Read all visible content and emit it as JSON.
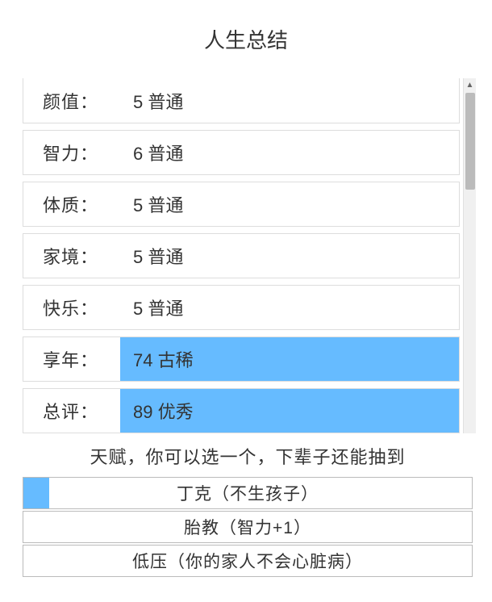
{
  "title": "人生总结",
  "stats": [
    {
      "label": "颜值：",
      "value": "5 普通",
      "highlighted": false
    },
    {
      "label": "智力：",
      "value": "6 普通",
      "highlighted": false
    },
    {
      "label": "体质：",
      "value": "5 普通",
      "highlighted": false
    },
    {
      "label": "家境：",
      "value": "5 普通",
      "highlighted": false
    },
    {
      "label": "快乐：",
      "value": "5 普通",
      "highlighted": false
    },
    {
      "label": "享年：",
      "value": "74 古稀",
      "highlighted": true
    },
    {
      "label": "总评：",
      "value": "89 优秀",
      "highlighted": true
    }
  ],
  "talent_title": "天赋，你可以选一个，下辈子还能抽到",
  "talents": [
    {
      "text": "丁克（不生孩子）",
      "selected": true
    },
    {
      "text": "胎教（智力+1）",
      "selected": false
    },
    {
      "text": "低压（你的家人不会心脏病）",
      "selected": false
    }
  ],
  "scroll_arrow": "▲"
}
